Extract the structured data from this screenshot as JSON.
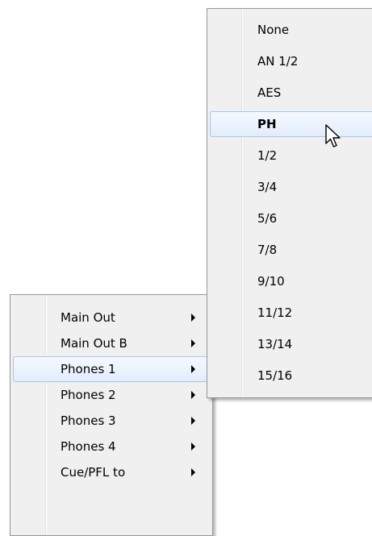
{
  "main_menu": {
    "items": [
      {
        "label": "Main Out",
        "submenu_arrow": "chevron-right-icon",
        "highlighted": false
      },
      {
        "label": "Main Out B",
        "submenu_arrow": "chevron-right-icon",
        "highlighted": false
      },
      {
        "label": "Phones 1",
        "submenu_arrow": "chevron-right-icon",
        "highlighted": true
      },
      {
        "label": "Phones 2",
        "submenu_arrow": "chevron-right-icon",
        "highlighted": false
      },
      {
        "label": "Phones 3",
        "submenu_arrow": "chevron-right-icon",
        "highlighted": false
      },
      {
        "label": "Phones 4",
        "submenu_arrow": "chevron-right-icon",
        "highlighted": false
      },
      {
        "label": "Cue/PFL to",
        "submenu_arrow": "chevron-right-icon",
        "highlighted": false
      }
    ]
  },
  "submenu": {
    "items": [
      {
        "label": "None"
      },
      {
        "label": "AN 1/2"
      },
      {
        "label": "AES"
      },
      {
        "label": "PH",
        "highlighted": true,
        "bold": true
      },
      {
        "label": "1/2"
      },
      {
        "label": "3/4"
      },
      {
        "label": "5/6"
      },
      {
        "label": "7/8"
      },
      {
        "label": "9/10"
      },
      {
        "label": "11/12"
      },
      {
        "label": "13/14"
      },
      {
        "label": "15/16"
      }
    ]
  },
  "cursor": {
    "icon": "mouse-pointer-icon"
  },
  "colors": {
    "menu_bg": "#f0f0f0",
    "menu_border": "#979797",
    "highlight_border": "#a8c6ee",
    "highlight_fill": "#e2edfb"
  }
}
